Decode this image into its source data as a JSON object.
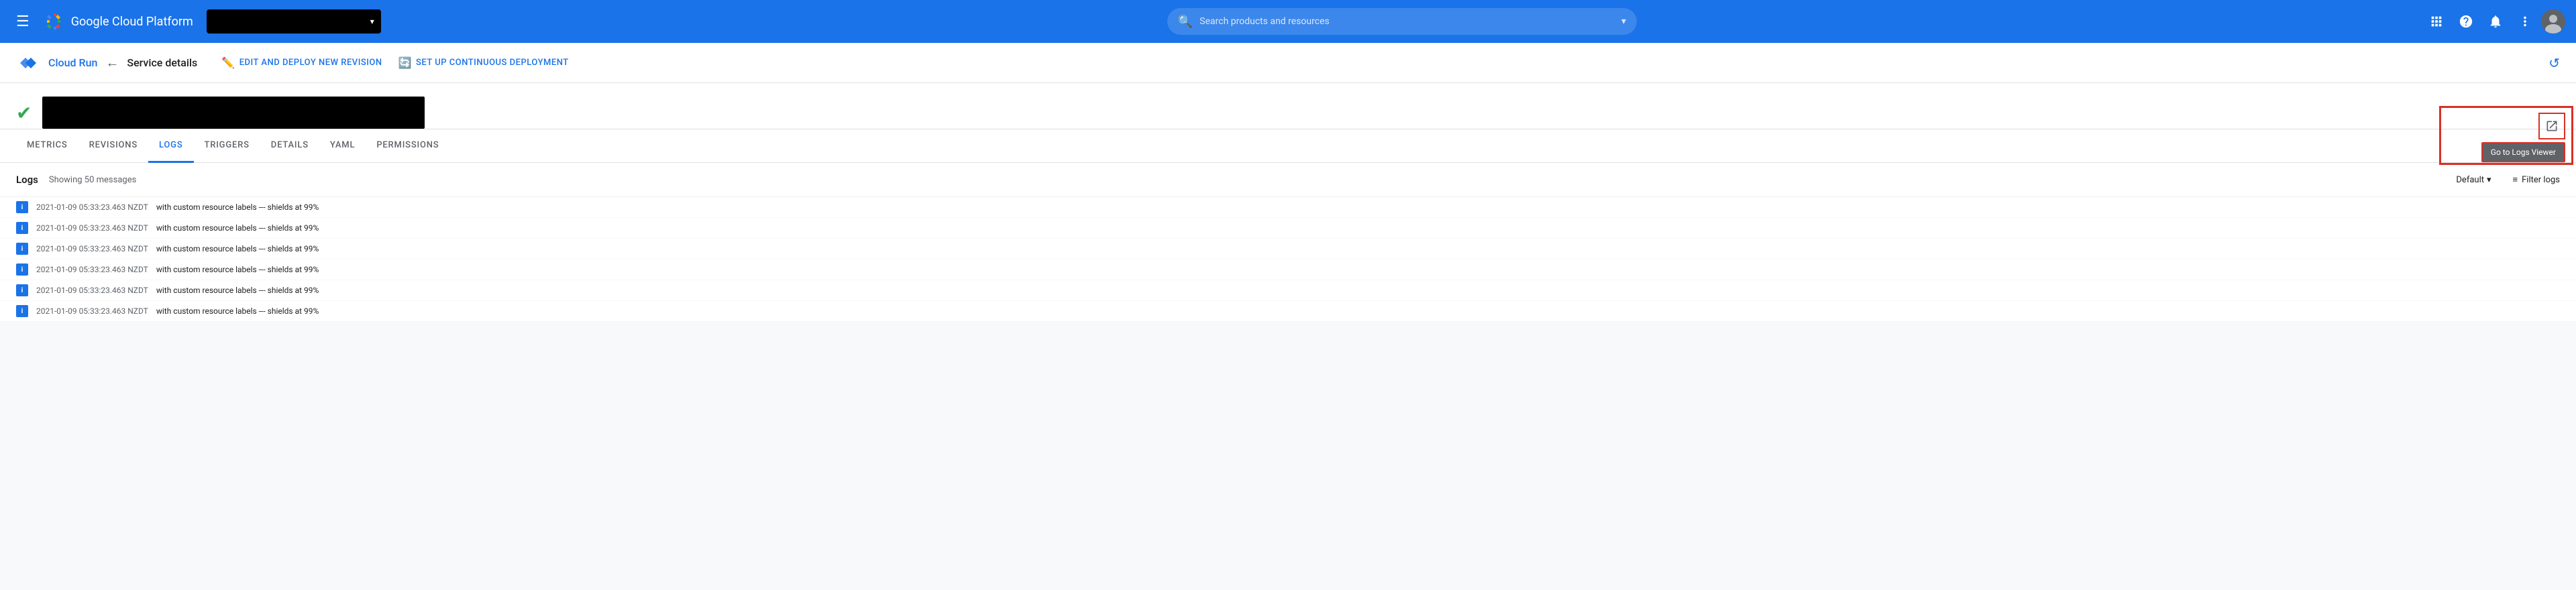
{
  "topNav": {
    "title": "Google Cloud Platform",
    "projectSelector": "",
    "searchPlaceholder": "Search products and resources",
    "hamburger": "☰",
    "searchIcon": "🔍",
    "chevronIcon": "▾",
    "icons": {
      "apps": "⊞",
      "help": "?",
      "notifications": "🔔",
      "more": "⋮"
    }
  },
  "breadcrumb": {
    "service": "Cloud Run",
    "arrow": "←",
    "current": "Service details",
    "editBtn": "EDIT AND DEPLOY NEW REVISION",
    "deployBtn": "SET UP CONTINUOUS DEPLOYMENT",
    "editIcon": "✏️",
    "deployIcon": "🔄",
    "refreshIcon": "↺"
  },
  "serviceStatus": {
    "checkIcon": "✔"
  },
  "tabs": [
    {
      "id": "metrics",
      "label": "METRICS",
      "active": false
    },
    {
      "id": "revisions",
      "label": "REVISIONS",
      "active": false
    },
    {
      "id": "logs",
      "label": "LOGS",
      "active": true
    },
    {
      "id": "triggers",
      "label": "TRIGGERS",
      "active": false
    },
    {
      "id": "details",
      "label": "DETAILS",
      "active": false
    },
    {
      "id": "yaml",
      "label": "YAML",
      "active": false
    },
    {
      "id": "permissions",
      "label": "PERMISSIONS",
      "active": false
    }
  ],
  "logsPanel": {
    "title": "Logs",
    "showing": "Showing 50 messages",
    "defaultLabel": "Default",
    "filterLabel": "Filter logs",
    "filterIcon": "≡"
  },
  "goToLogs": {
    "label": "Go to Logs Viewer",
    "icon": "↗"
  },
  "logRows": [
    {
      "level": "i",
      "timestamp": "2021-01-09 05:33:23.463 NZDT",
      "message": "with custom resource labels --- shields at 99%"
    },
    {
      "level": "i",
      "timestamp": "2021-01-09 05:33:23.463 NZDT",
      "message": "with custom resource labels --- shields at 99%"
    },
    {
      "level": "i",
      "timestamp": "2021-01-09 05:33:23.463 NZDT",
      "message": "with custom resource labels --- shields at 99%"
    },
    {
      "level": "i",
      "timestamp": "2021-01-09 05:33:23.463 NZDT",
      "message": "with custom resource labels --- shields at 99%"
    },
    {
      "level": "i",
      "timestamp": "2021-01-09 05:33:23.463 NZDT",
      "message": "with custom resource labels --- shields at 99%"
    },
    {
      "level": "i",
      "timestamp": "2021-01-09 05:33:23.463 NZDT",
      "message": "with custom resource labels --- shields at 99%"
    }
  ]
}
